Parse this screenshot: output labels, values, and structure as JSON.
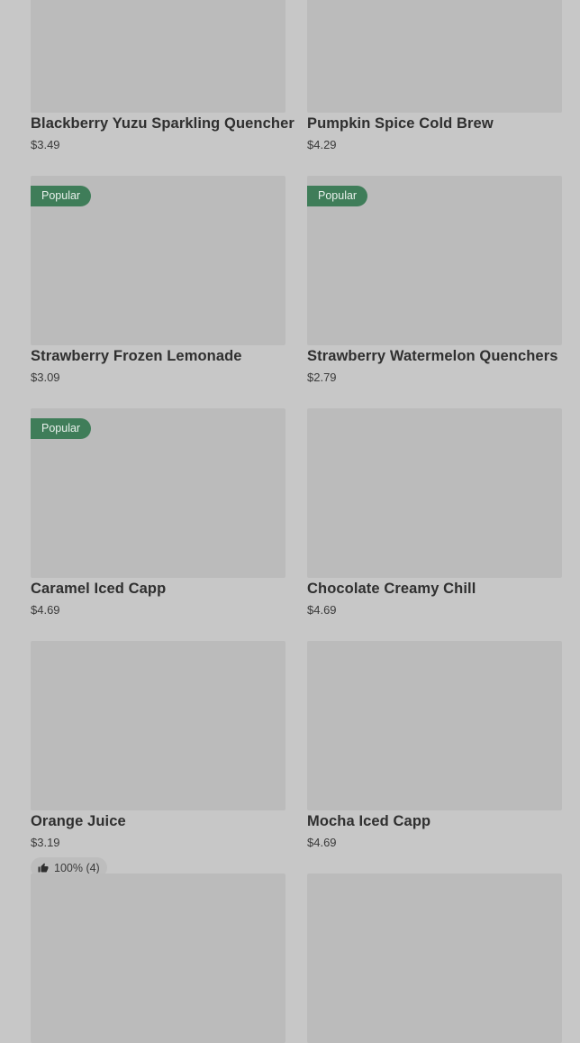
{
  "products": [
    {
      "name": "Blackberry Yuzu Sparkling Quencher",
      "price": "$3.49",
      "badge": ""
    },
    {
      "name": "Pumpkin Spice Cold Brew",
      "price": "$4.29",
      "badge": ""
    },
    {
      "name": "Strawberry Frozen Lemonade",
      "price": "$3.09",
      "badge": "Popular"
    },
    {
      "name": "Strawberry Watermelon Quenchers",
      "price": "$2.79",
      "badge": "Popular"
    },
    {
      "name": "Caramel Iced Capp",
      "price": "$4.69",
      "badge": "Popular"
    },
    {
      "name": "Chocolate Creamy Chill",
      "price": "$4.69",
      "badge": ""
    },
    {
      "name": "Orange Juice",
      "price": "$3.19",
      "badge": "",
      "rating": "100% (4)"
    },
    {
      "name": "Mocha Iced Capp",
      "price": "$4.69",
      "badge": ""
    },
    {
      "name": "",
      "price": "",
      "badge": ""
    },
    {
      "name": "",
      "price": "",
      "badge": ""
    }
  ],
  "colors": {
    "badge_bg": "#3f7d59",
    "overlay": "#c7c7c7"
  },
  "icons": {
    "rating": "thumbs-up-icon"
  }
}
